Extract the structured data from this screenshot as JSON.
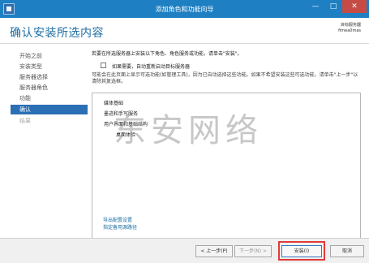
{
  "window": {
    "title": "添加角色和功能向导",
    "minimize": "—",
    "maximize": "□",
    "close": "✕"
  },
  "header": {
    "page_title": "确认安装所选内容",
    "dest_label": "目标服务器",
    "dest_server": "fimea0mas"
  },
  "sidebar": {
    "items": [
      {
        "label": "开始之前",
        "state": "normal"
      },
      {
        "label": "安装类型",
        "state": "normal"
      },
      {
        "label": "服务器选择",
        "state": "normal"
      },
      {
        "label": "服务器角色",
        "state": "normal"
      },
      {
        "label": "功能",
        "state": "normal"
      },
      {
        "label": "确认",
        "state": "active"
      },
      {
        "label": "结果",
        "state": "disabled"
      }
    ]
  },
  "main": {
    "intro": "若要在所选服务器上安装以下角色、角色服务或功能，请单击\"安装\"。",
    "restart_checkbox": {
      "label": "如果需要，自动重新启动目标服务器",
      "checked": false
    },
    "warning": "可能会在此页面上显示可选功能(如管理工具)，因为已自动选择这些功能。如果不希望安装这些可选功能，请单击\"上一步\"以清除其复选框。",
    "features": [
      {
        "label": "媒体基础",
        "level": 0
      },
      {
        "label": "墨迹和手写服务",
        "level": 0
      },
      {
        "label": "用户界面和基础结构",
        "level": 0
      },
      {
        "label": "桌面体验",
        "level": 1
      }
    ],
    "links": {
      "export": "导出配置设置",
      "alt_source": "指定备用源路径"
    }
  },
  "watermark": "东安网络",
  "footer": {
    "prev": "< 上一步(P)",
    "next": "下一步(N) >",
    "install": "安装(I)",
    "cancel": "取消"
  }
}
